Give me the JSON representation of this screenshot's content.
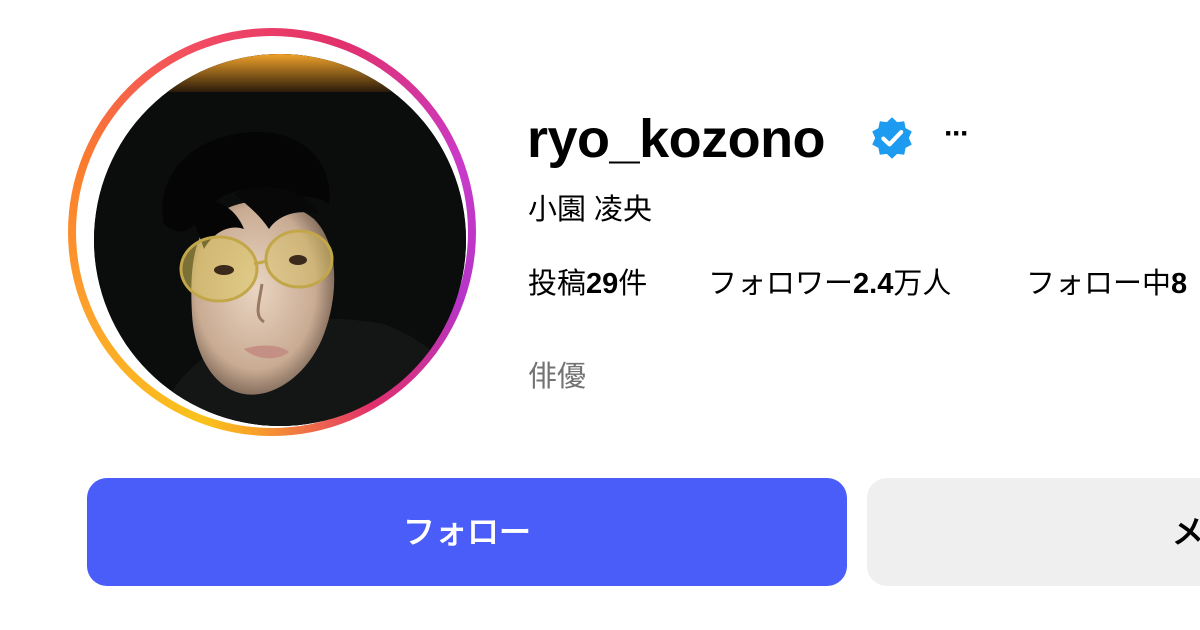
{
  "profile": {
    "username": "ryo_kozono",
    "verified_icon": "verified-badge-icon",
    "more_label": "···",
    "full_name": "小園 凌央",
    "stats": {
      "posts_prefix": "投稿",
      "posts_value": "29",
      "posts_suffix": "件",
      "followers_prefix": "フォロワー",
      "followers_value": "2.4",
      "followers_suffix": "万人",
      "following_prefix": "フォロー中",
      "following_value": "8"
    },
    "bio": "俳優"
  },
  "actions": {
    "follow_label": "フォロー",
    "message_label": "メ"
  },
  "colors": {
    "follow_button": "#4a5df9",
    "verified": "#1d9bf0",
    "secondary_button": "#efefef",
    "bio_text": "#737373"
  }
}
